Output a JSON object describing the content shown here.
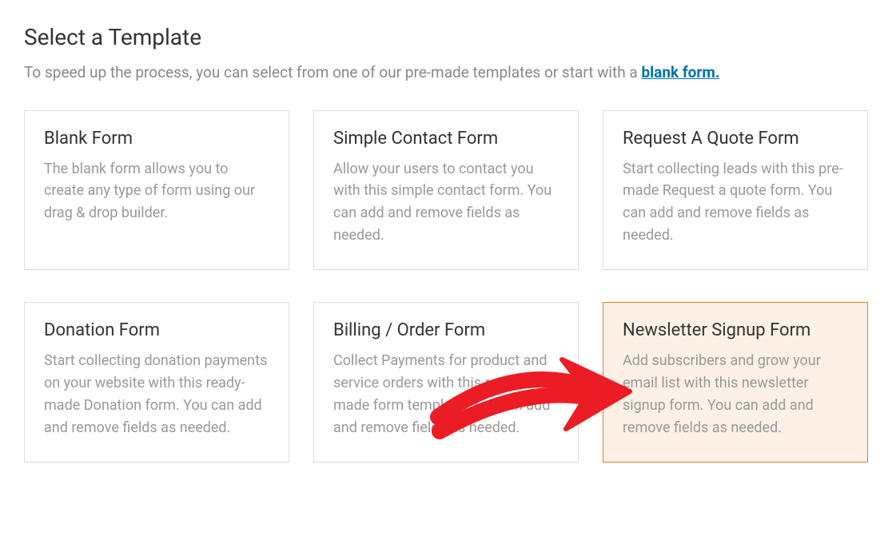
{
  "header": {
    "title": "Select a Template",
    "subtitle_prefix": "To speed up the process, you can select from one of our pre-made templates or start with a ",
    "subtitle_link": "blank form."
  },
  "templates": [
    {
      "title": "Blank Form",
      "description": "The blank form allows you to create any type of form using our drag & drop builder.",
      "highlighted": false
    },
    {
      "title": "Simple Contact Form",
      "description": "Allow your users to contact you with this simple contact form. You can add and remove fields as needed.",
      "highlighted": false
    },
    {
      "title": "Request A Quote Form",
      "description": "Start collecting leads with this pre-made Request a quote form. You can add and remove fields as needed.",
      "highlighted": false
    },
    {
      "title": "Donation Form",
      "description": "Start collecting donation payments on your website with this ready-made Donation form. You can add and remove fields as needed.",
      "highlighted": false
    },
    {
      "title": "Billing / Order Form",
      "description": "Collect Payments for product and service orders with this ready-made form template. You can add and remove fields as needed.",
      "highlighted": false
    },
    {
      "title": "Newsletter Signup Form",
      "description": "Add subscribers and grow your email list with this newsletter signup form. You can add and remove fields as needed.",
      "highlighted": true
    }
  ],
  "colors": {
    "accent_link": "#0073aa",
    "highlight_border": "#e67e22",
    "highlight_bg": "#fdf1e6",
    "arrow": "#ec1c24"
  }
}
